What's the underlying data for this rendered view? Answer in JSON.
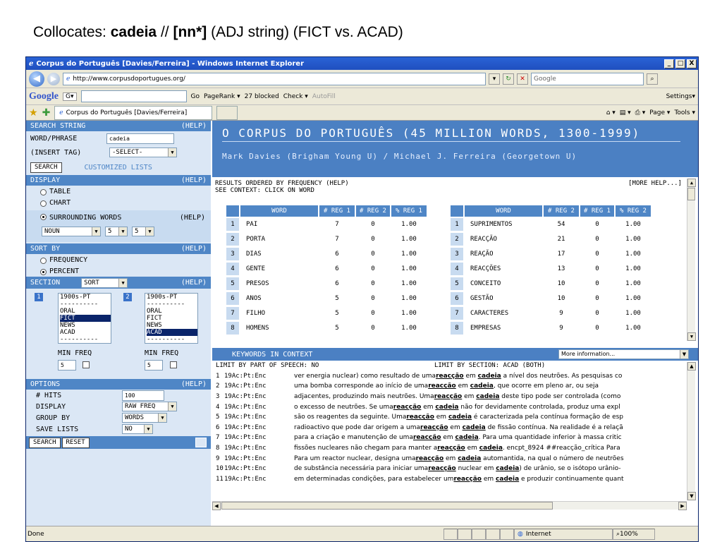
{
  "slide_title": {
    "prefix": "Collocates: ",
    "word": "cadeia",
    "sep": " // ",
    "pos": "[nn*]",
    "suffix": " (ADJ string) (FICT vs. ACAD)"
  },
  "window": {
    "title": "Corpus do Português [Davies/Ferreira] - Windows Internet Explorer",
    "min": "_",
    "max": "□",
    "close": "X"
  },
  "address": {
    "url": "http://www.corpusdoportugues.org/",
    "search_placeholder": "Google"
  },
  "google_bar": {
    "logo": "Google",
    "g_label": "G▾",
    "go": "Go",
    "pagerank": "PageRank ▾",
    "blocked": "27 blocked",
    "check": "Check ▾",
    "autofill": "AutoFill",
    "settings": "Settings▾"
  },
  "tab": {
    "label": "Corpus do Português [Davies/Ferreira]",
    "page_menu": "Page ▾",
    "tools_menu": "Tools ▾"
  },
  "left": {
    "search_string": "SEARCH STRING",
    "help": "(HELP)",
    "word_phrase_label": "WORD/PHRASE",
    "word_phrase_value": "cadeia",
    "insert_tag_label": "(INSERT TAG)",
    "insert_tag_value": "-SELECT-",
    "search_btn": "SEARCH",
    "customized_lists": "CUSTOMIZED LISTS",
    "display": "DISPLAY",
    "table": "TABLE",
    "chart": "CHART",
    "surrounding": "SURROUNDING WORDS",
    "noun_value": "NOUN",
    "left_span": "5",
    "right_span": "5",
    "sort_by": "SORT BY",
    "frequency": "FREQUENCY",
    "percent": "PERCENT",
    "section": "SECTION",
    "section_sort": "SORT",
    "list1_num": "1",
    "list2_num": "2",
    "list1": [
      "1900s-PT",
      "----------",
      "ORAL",
      "FICT",
      "NEWS",
      "ACAD",
      "----------"
    ],
    "list2": [
      "1900s-PT",
      "----------",
      "ORAL",
      "FICT",
      "NEWS",
      "ACAD",
      "----------"
    ],
    "min_freq": "MIN FREQ",
    "min_freq1": "5",
    "min_freq2": "5",
    "options": "OPTIONS",
    "hits_label": "# HITS",
    "hits_value": "100",
    "display_label": "DISPLAY",
    "display_value": "RAW FREQ",
    "group_label": "GROUP BY",
    "group_value": "WORDS",
    "save_label": "SAVE LISTS",
    "save_value": "NO",
    "search_btn2": "SEARCH",
    "reset_btn": "RESET"
  },
  "banner": {
    "title": "O CORPUS DO PORTUGUÊS (45 MILLION WORDS, 1300-1999)",
    "subtitle": "Mark Davies (Brigham Young U) / Michael J. Ferreira (Georgetown U)"
  },
  "results": {
    "line1": "RESULTS ORDERED BY FREQUENCY (HELP)",
    "line2": "SEE CONTEXT: CLICK ON WORD",
    "more_help": "[MORE HELP...]",
    "left_headers": [
      "WORD",
      "# REG 1",
      "# REG 2",
      "% REG 1"
    ],
    "right_headers": [
      "WORD",
      "# REG 2",
      "# REG 1",
      "% REG 2"
    ],
    "left_rows": [
      [
        "1",
        "PAI",
        "7",
        "0",
        "1.00"
      ],
      [
        "2",
        "PORTA",
        "7",
        "0",
        "1.00"
      ],
      [
        "3",
        "DIAS",
        "6",
        "0",
        "1.00"
      ],
      [
        "4",
        "GENTE",
        "6",
        "0",
        "1.00"
      ],
      [
        "5",
        "PRESOS",
        "6",
        "0",
        "1.00"
      ],
      [
        "6",
        "ANOS",
        "5",
        "0",
        "1.00"
      ],
      [
        "7",
        "FILHO",
        "5",
        "0",
        "1.00"
      ],
      [
        "8",
        "HOMENS",
        "5",
        "0",
        "1.00"
      ]
    ],
    "right_rows": [
      [
        "1",
        "SUPRIMENTOS",
        "54",
        "0",
        "1.00"
      ],
      [
        "2",
        "REACÇÃO",
        "21",
        "0",
        "1.00"
      ],
      [
        "3",
        "REAÇÃO",
        "17",
        "0",
        "1.00"
      ],
      [
        "4",
        "REACÇÕES",
        "13",
        "0",
        "1.00"
      ],
      [
        "5",
        "CONCEITO",
        "10",
        "0",
        "1.00"
      ],
      [
        "6",
        "GESTÃO",
        "10",
        "0",
        "1.00"
      ],
      [
        "7",
        "CARACTERES",
        "9",
        "0",
        "1.00"
      ],
      [
        "8",
        "EMPRESAS",
        "9",
        "0",
        "1.00"
      ]
    ]
  },
  "kwic": {
    "header": "KEYWORDS IN CONTEXT",
    "more_info": "More information...",
    "limit_pos": "LIMIT BY PART OF SPEECH: NO",
    "limit_section": "LIMIT BY SECTION:  ACAD (BOTH)",
    "lines": [
      {
        "n": "1",
        "src": "19Ac:Pt:Enc",
        "pre": "ver energia nuclear) como resultado de uma ",
        "kw1": "reacção",
        "mid": " em ",
        "kw2": "cadeia",
        "post": " a nível dos neutrões. As pesquisas co"
      },
      {
        "n": "2",
        "src": "19Ac:Pt:Enc",
        "pre": "uma bomba corresponde ao início de uma ",
        "kw1": "reacção",
        "mid": " em ",
        "kw2": "cadeia",
        "post": ", que ocorre em pleno ar, ou seja"
      },
      {
        "n": "3",
        "src": "19Ac:Pt:Enc",
        "pre": "adjacentes, produzindo mais neutrões. Uma ",
        "kw1": "reacção",
        "mid": " em ",
        "kw2": "cadeia",
        "post": " deste tipo pode ser controlada (como"
      },
      {
        "n": "4",
        "src": "19Ac:Pt:Enc",
        "pre": "o excesso de neutrões. Se uma ",
        "kw1": "reacção",
        "mid": " em ",
        "kw2": "cadeia",
        "post": " não for devidamente controlada, produz uma expl"
      },
      {
        "n": "5",
        "src": "19Ac:Pt:Enc",
        "pre": "são os reagentes da seguinte. Uma ",
        "kw1": "reacção",
        "mid": " em ",
        "kw2": "cadeia",
        "post": " é caracterizada pela contínua formação de esp"
      },
      {
        "n": "6",
        "src": "19Ac:Pt:Enc",
        "pre": "radioactivo que pode dar origem a uma ",
        "kw1": "reacção",
        "mid": " em ",
        "kw2": "cadeia",
        "post": " de fissão contínua. Na realidade é a relaçã"
      },
      {
        "n": "7",
        "src": "19Ac:Pt:Enc",
        "pre": "para a criação e manutenção de uma ",
        "kw1": "reacção",
        "mid": " em ",
        "kw2": "cadeia",
        "post": ". Para uma quantidade inferior à massa critic"
      },
      {
        "n": "8",
        "src": "19Ac:Pt:Enc",
        "pre": "fissões nucleares não chegam para manter a ",
        "kw1": "reacção",
        "mid": " em ",
        "kw2": "cadeia",
        "post": ". encpt_8924 ##reacção_crítica Para"
      },
      {
        "n": "9",
        "src": "19Ac:Pt:Enc",
        "pre": "Para um reactor nuclear, designa uma ",
        "kw1": "reacção",
        "mid": " em ",
        "kw2": "cadeia",
        "post": " automantida, na qual o número de neutrões"
      },
      {
        "n": "10",
        "src": "19Ac:Pt:Enc",
        "pre": "de substância necessária para iniciar uma ",
        "kw1": "reacção",
        "mid": " nuclear em ",
        "kw2": "cadeia",
        "post": ") de urânio, se o isótopo urânio-"
      },
      {
        "n": "11",
        "src": "19Ac:Pt:Enc",
        "pre": "em determinadas condições, para estabelecer um ",
        "kw1": "reacção",
        "mid": " em ",
        "kw2": "cadeia",
        "post": " e produzir continuamente quant"
      }
    ]
  },
  "status": {
    "done": "Done",
    "zone": "Internet",
    "zoom": "100%"
  }
}
